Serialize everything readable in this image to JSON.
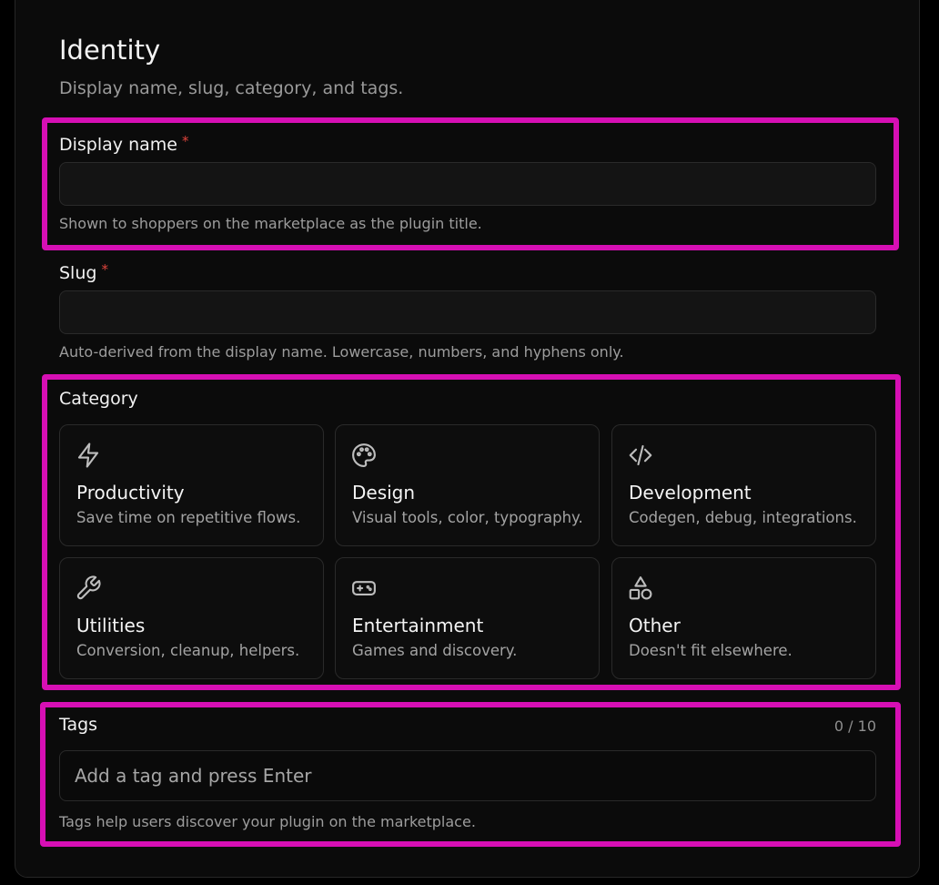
{
  "section": {
    "title": "Identity",
    "subtitle": "Display name, slug, category, and tags."
  },
  "display_name": {
    "label": "Display name",
    "required_mark": "*",
    "value": "",
    "placeholder": "",
    "helper": "Shown to shoppers on the marketplace as the plugin title."
  },
  "slug": {
    "label": "Slug",
    "required_mark": "*",
    "value": "",
    "placeholder": "",
    "helper": "Auto-derived from the display name. Lowercase, numbers, and hyphens only."
  },
  "category": {
    "label": "Category",
    "options": [
      {
        "name": "Productivity",
        "description": "Save time on repetitive flows.",
        "icon": "lightning-icon"
      },
      {
        "name": "Design",
        "description": "Visual tools, color, typography.",
        "icon": "palette-icon"
      },
      {
        "name": "Development",
        "description": "Codegen, debug, integrations.",
        "icon": "code-icon"
      },
      {
        "name": "Utilities",
        "description": "Conversion, cleanup, helpers.",
        "icon": "wrench-icon"
      },
      {
        "name": "Entertainment",
        "description": "Games and discovery.",
        "icon": "gamepad-icon"
      },
      {
        "name": "Other",
        "description": "Doesn't fit elsewhere.",
        "icon": "shapes-icon"
      }
    ]
  },
  "tags": {
    "label": "Tags",
    "count": "0 / 10",
    "placeholder": "Add a tag and press Enter",
    "helper": "Tags help users discover your plugin on the marketplace."
  },
  "colors": {
    "highlight": "#d60fb4",
    "required": "#e0443c",
    "background": "#0b0b0b"
  }
}
